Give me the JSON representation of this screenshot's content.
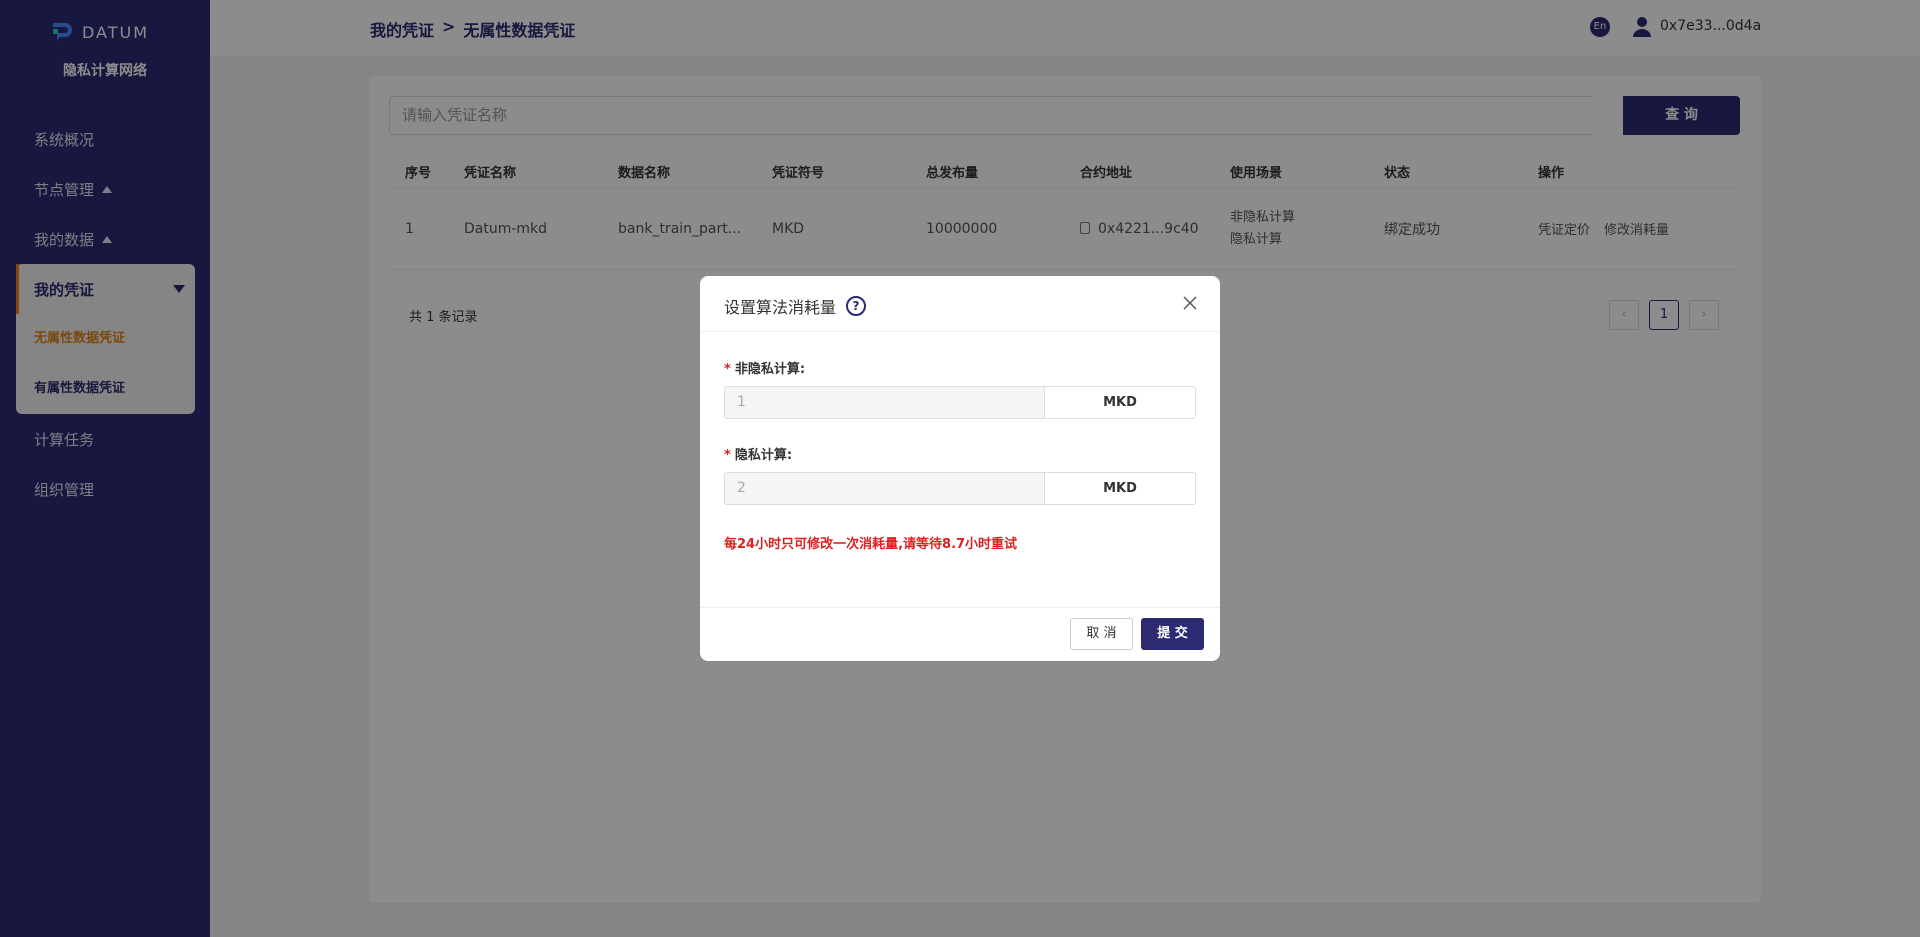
{
  "sidebar": {
    "logo_text": "DATUM",
    "subtitle": "隐私计算网络",
    "items": [
      {
        "label": "系统概况"
      },
      {
        "label": "节点管理"
      },
      {
        "label": "我的数据"
      },
      {
        "label": "我的凭证"
      },
      {
        "label": "计算任务"
      },
      {
        "label": "组织管理"
      }
    ],
    "sub_items": [
      {
        "label": "无属性数据凭证",
        "active": true
      },
      {
        "label": "有属性数据凭证",
        "active": false
      }
    ]
  },
  "header": {
    "breadcrumb": [
      "我的凭证",
      ">",
      "无属性数据凭证"
    ],
    "lang": "En",
    "wallet": "0x7e33...0d4a"
  },
  "search": {
    "placeholder": "请输入凭证名称",
    "button": "查 询"
  },
  "table": {
    "columns": [
      "序号",
      "凭证名称",
      "数据名称",
      "凭证符号",
      "总发布量",
      "合约地址",
      "使用场景",
      "状态",
      "操作"
    ],
    "rows": [
      {
        "index": "1",
        "credential_name": "Datum-mkd",
        "data_name": "bank_train_part...",
        "symbol": "MKD",
        "total": "10000000",
        "contract": "0x4221...9c40",
        "scenarios": [
          "非隐私计算",
          "隐私计算"
        ],
        "status": "绑定成功",
        "actions": [
          "凭证定价",
          "修改消耗量"
        ]
      }
    ]
  },
  "pagination": {
    "total_text": "共 1 条记录",
    "current": "1"
  },
  "modal": {
    "title": "设置算法消耗量",
    "help": "?",
    "fields": [
      {
        "label": "非隐私计算:",
        "value": "1",
        "unit": "MKD"
      },
      {
        "label": "隐私计算:",
        "value": "2",
        "unit": "MKD"
      }
    ],
    "required_mark": "*",
    "warning": "每24小时只可修改一次消耗量,请等待8.7小时重试",
    "cancel": "取 消",
    "submit": "提 交"
  },
  "colors": {
    "brand": "#2c2a73",
    "accent": "#ff7a18",
    "error": "#e02020"
  }
}
